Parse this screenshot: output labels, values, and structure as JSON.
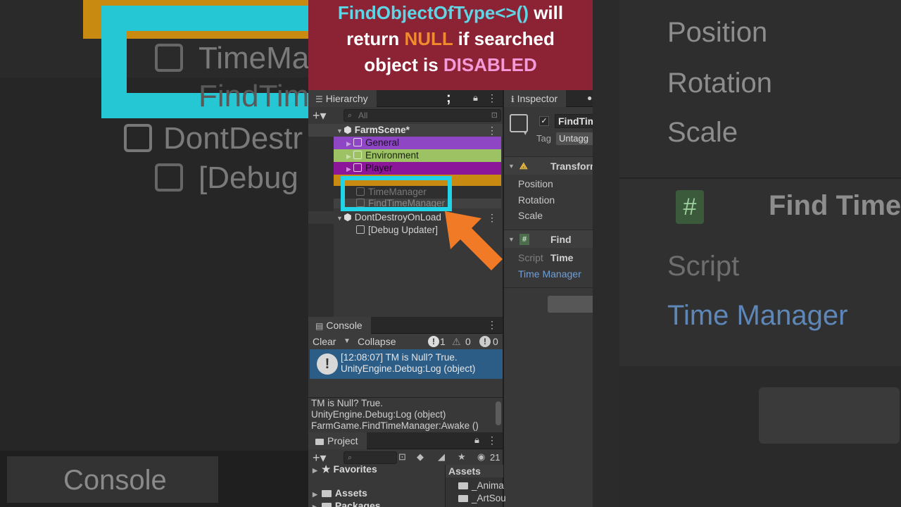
{
  "banner": {
    "l1a": "FindObjectOfType<>()",
    "l1b": " will",
    "l2a": "return ",
    "l2b": "NULL",
    "l2c": " if searched",
    "l3a": "object is ",
    "l3b": "DISABLED"
  },
  "bg_left": {
    "t1": "TimeMa",
    "t2": "FindTim",
    "t3": "DontDestr",
    "t4": "[Debug",
    "console": "Console"
  },
  "bg_right": {
    "position": "Position",
    "rotation": "Rotation",
    "scale": "Scale",
    "find": "Find Time",
    "hash": "#",
    "script": "Script",
    "time_manager": "Time Manager"
  },
  "hierarchy": {
    "tab": "Hierarchy",
    "search_placeholder": "All",
    "scene": "FarmScene*",
    "items": {
      "general": "General",
      "environment": "Environment",
      "player": "Player",
      "timemanager": "TimeManager",
      "findtimemanager": "FindTimeManager",
      "dontdestroy": "DontDestroyOnLoad",
      "debug_updater": "[Debug Updater]"
    }
  },
  "inspector": {
    "tab": "Inspector",
    "name": "FindTim",
    "tag_label": "Tag",
    "tag_value": "Untagg",
    "transform": "Transform",
    "position": "Position",
    "rotation": "Rotation",
    "scale": "Scale",
    "component": "Find Time",
    "script_label": "Script",
    "script_value": "Time Manager"
  },
  "console": {
    "tab": "Console",
    "clear": "Clear",
    "collapse": "Collapse",
    "count_log": "1",
    "count_warn": "0",
    "count_err": "0",
    "log_line1": "[12:08:07] TM is Null? True.",
    "log_line2": "UnityEngine.Debug:Log (object)",
    "detail1": "TM is Null? True.",
    "detail2": "UnityEngine.Debug:Log (object)",
    "detail3": "FarmGame.FindTimeManager:Awake ()"
  },
  "project": {
    "tab": "Project",
    "hidden_count": "21",
    "favorites": "Favorites",
    "assets": "Assets",
    "packages": "Packages",
    "assets_header": "Assets",
    "folder1": "_Anima",
    "folder2": "_ArtSou"
  },
  "colors": {
    "banner_bg": "#8b2335",
    "cyan": "#5ed6e6",
    "orange": "#f28a2e",
    "pink": "#f59ad8",
    "highlight": "#21d3e6",
    "general_row": "#8e46c5",
    "environment_row": "#9cc264",
    "player_row": "#8b169a",
    "timemanager_row": "#c98a12",
    "log_selected": "#2c5d87"
  }
}
